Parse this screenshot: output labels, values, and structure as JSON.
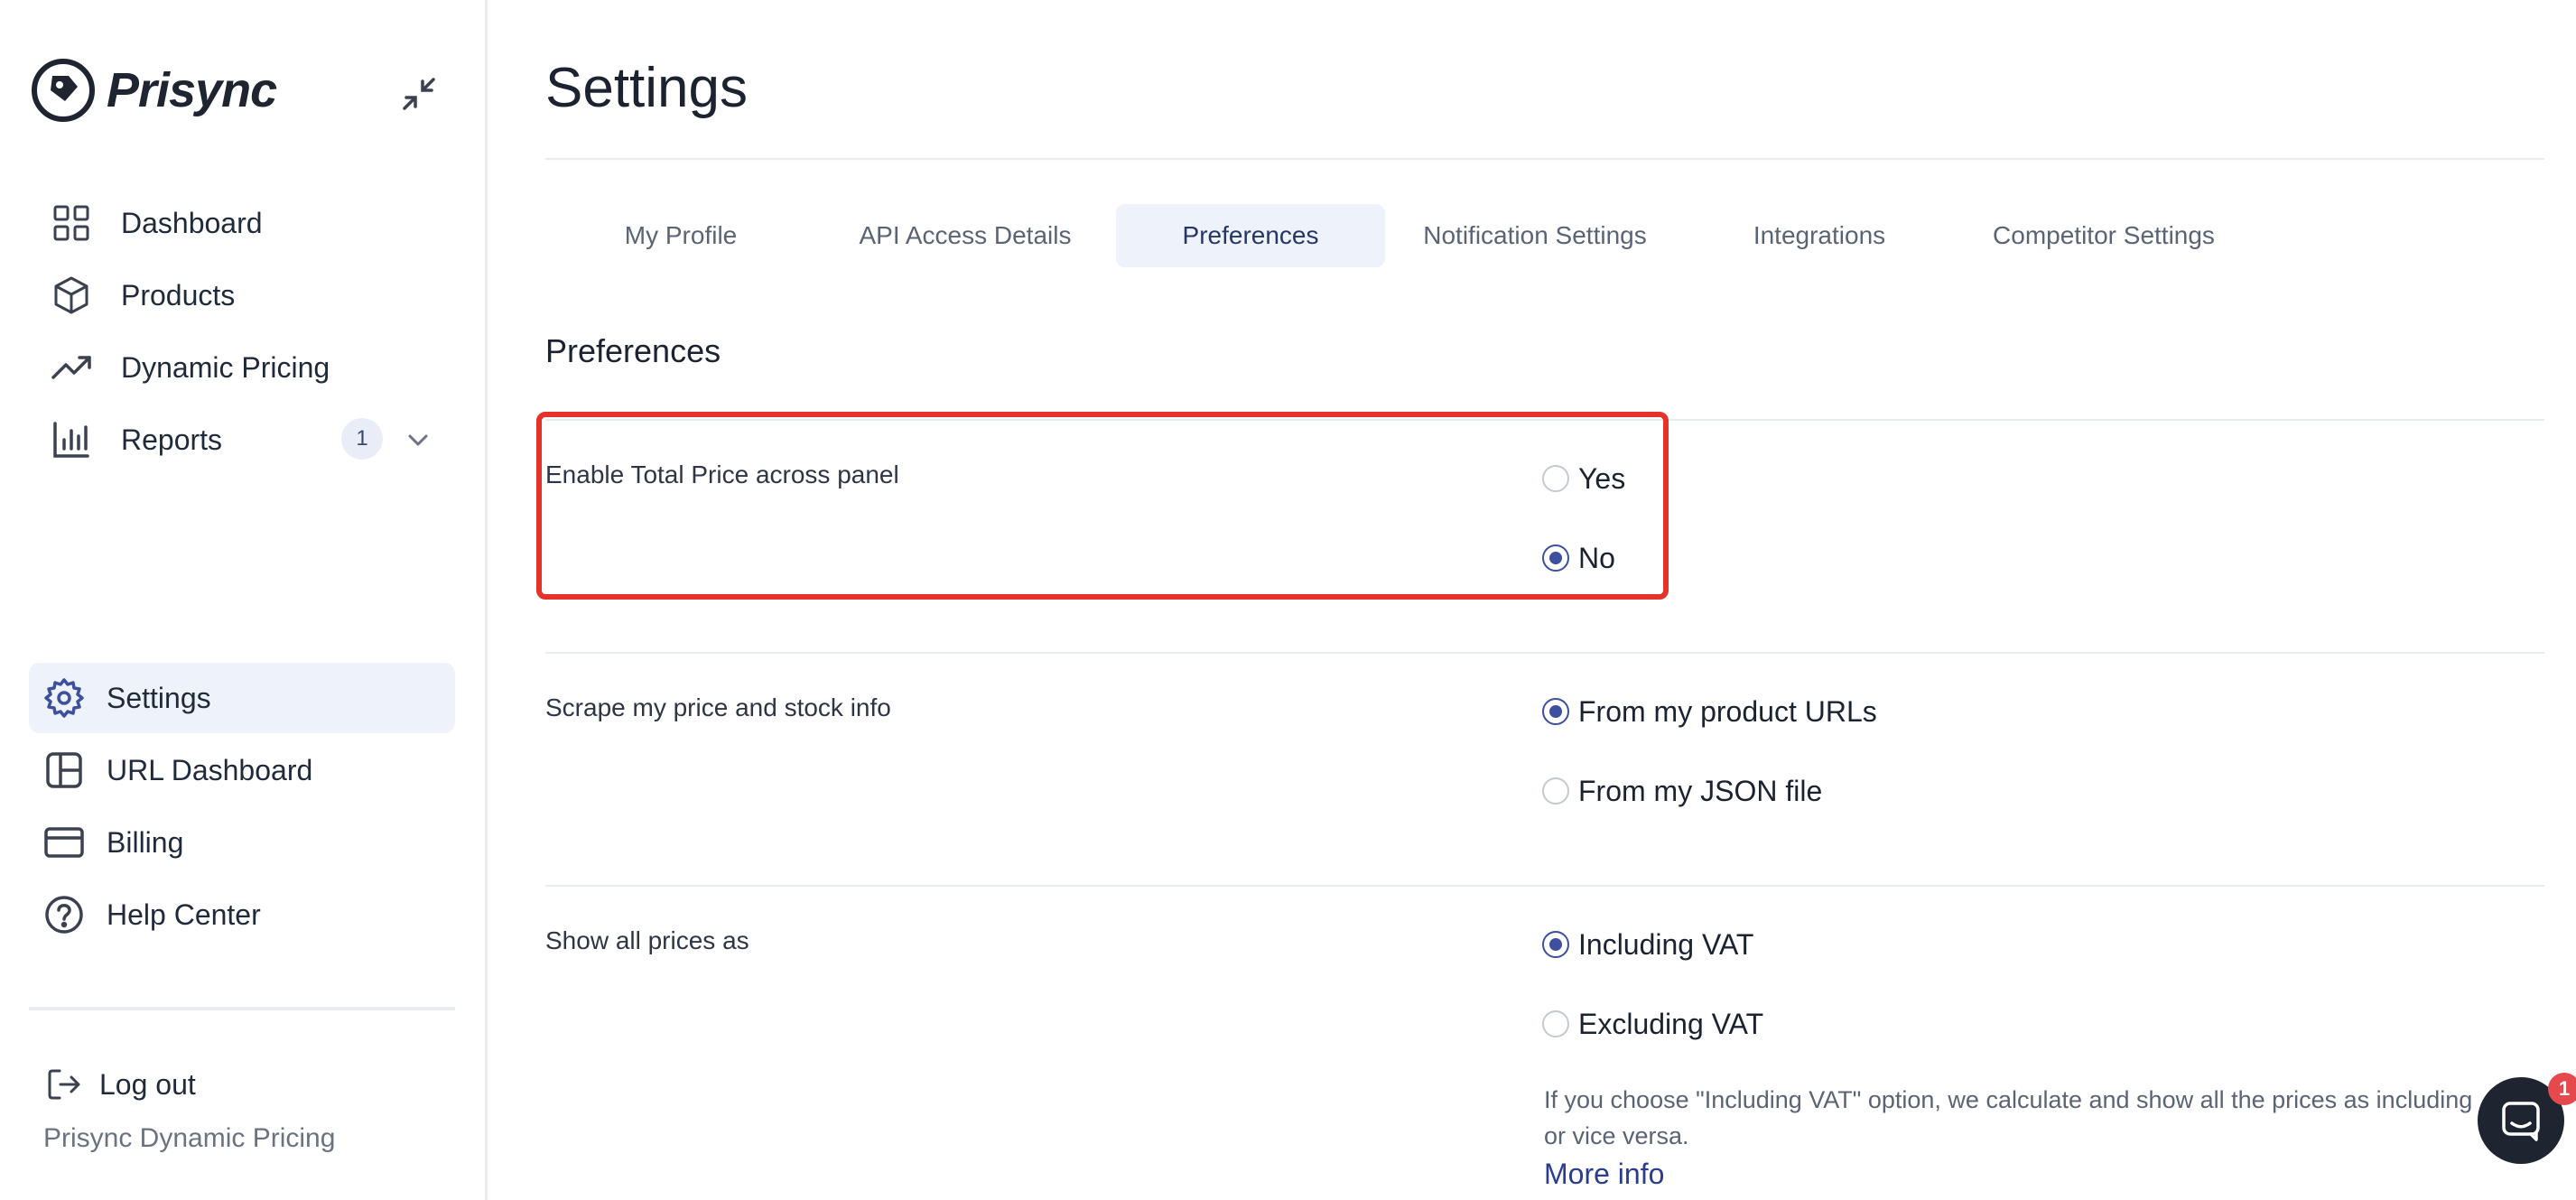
{
  "app": {
    "name": "Prisync"
  },
  "sidebar": {
    "items": [
      {
        "label": "Dashboard",
        "icon": "grid-icon"
      },
      {
        "label": "Products",
        "icon": "box-icon"
      },
      {
        "label": "Dynamic Pricing",
        "icon": "trending-up-icon"
      },
      {
        "label": "Reports",
        "icon": "bar-chart-icon",
        "badge": "1"
      },
      {
        "label": "Settings",
        "icon": "gear-icon",
        "active": true
      },
      {
        "label": "URL Dashboard",
        "icon": "layout-icon"
      },
      {
        "label": "Billing",
        "icon": "credit-card-icon"
      },
      {
        "label": "Help Center",
        "icon": "help-circle-icon"
      }
    ],
    "logout_label": "Log out",
    "company": "Prisync Dynamic Pricing"
  },
  "main": {
    "title": "Settings",
    "tabs": [
      {
        "label": "My Profile"
      },
      {
        "label": "API Access Details"
      },
      {
        "label": "Preferences",
        "active": true
      },
      {
        "label": "Notification Settings"
      },
      {
        "label": "Integrations"
      },
      {
        "label": "Competitor Settings"
      }
    ],
    "section_title": "Preferences",
    "preferences": [
      {
        "label": "Enable Total Price across panel",
        "options": [
          "Yes",
          "No"
        ],
        "selected": "No"
      },
      {
        "label": "Scrape my price and stock info",
        "options": [
          "From my product URLs",
          "From my JSON file"
        ],
        "selected": "From my product URLs"
      },
      {
        "label": "Show all prices as",
        "options": [
          "Including VAT",
          "Excluding VAT"
        ],
        "selected": "Including VAT"
      }
    ],
    "vat_help_line1": "If you choose \"Including VAT\" option, we calculate and show all the prices as including",
    "vat_help_line2": "or vice versa.",
    "more_info": "More info"
  },
  "chat": {
    "badge": "1"
  },
  "colors": {
    "accent": "#3d4f9f",
    "highlight": "#e63329",
    "active_bg": "#eef2fb"
  }
}
